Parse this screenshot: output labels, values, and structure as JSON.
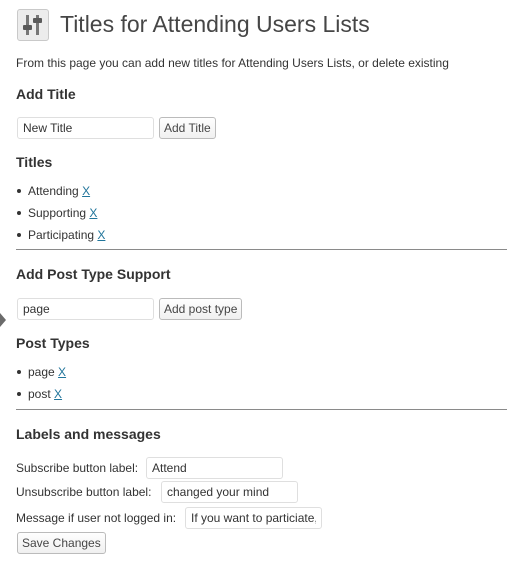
{
  "header": {
    "icon": "settings-sliders-icon",
    "title": "Titles for Attending Users Lists"
  },
  "intro": "From this page you can add new titles for Attending Users Lists, or delete existing",
  "add_title": {
    "heading": "Add Title",
    "input_value": "New Title",
    "button_label": "Add Title"
  },
  "titles": {
    "heading": "Titles",
    "delete_label": "X",
    "items": [
      "Attending",
      "Supporting",
      "Participating"
    ]
  },
  "add_post_type": {
    "heading": "Add Post Type Support",
    "input_value": "page",
    "button_label": "Add post type"
  },
  "post_types": {
    "heading": "Post Types",
    "delete_label": "X",
    "items": [
      "page",
      "post"
    ]
  },
  "labels_messages": {
    "heading": "Labels and messages",
    "subscribe_label": "Subscribe button label:",
    "subscribe_value": "Attend",
    "unsubscribe_label": "Unsubscribe button label:",
    "unsubscribe_value": "changed your mind",
    "not_logged_label": "Message if user not logged in:",
    "not_logged_value": "If you want to particiate, please",
    "save_button": "Save Changes"
  },
  "colors": {
    "link": "#21759b",
    "title_text": "#464646",
    "divider": "#8a8a8a"
  }
}
